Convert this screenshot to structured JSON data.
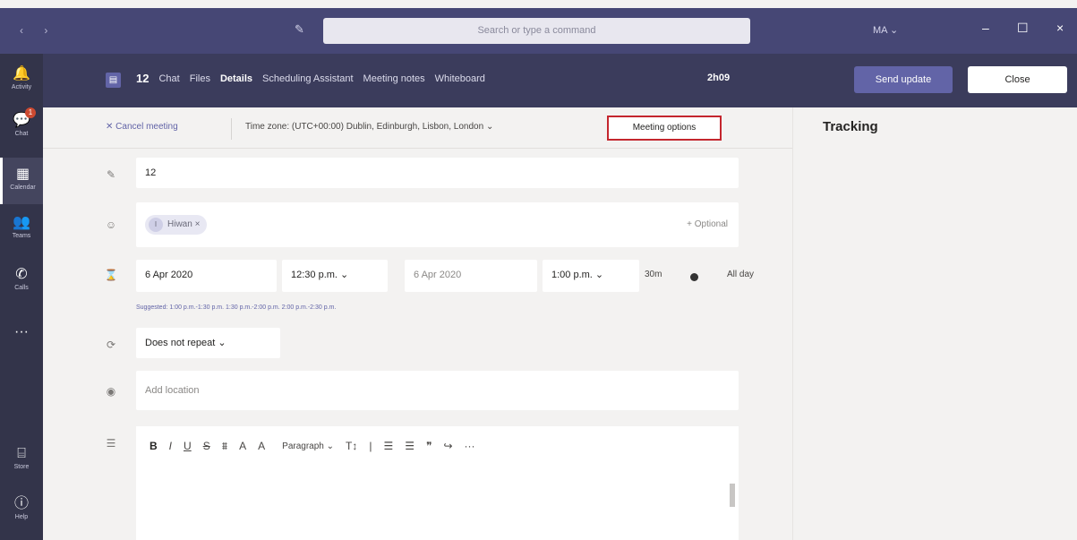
{
  "titlebar": {
    "search_placeholder": "Search or type a command",
    "user": "MA",
    "nav_arrows": "‹ ›",
    "compose_icon": "compose-icon",
    "min": "–",
    "max": "☐",
    "close": "×"
  },
  "rail": {
    "items": [
      {
        "label": "Activity",
        "icon": "bell-icon",
        "glyph": "🔔"
      },
      {
        "label": "Chat",
        "icon": "chat-icon",
        "glyph": "💬",
        "badge": "1"
      },
      {
        "label": "Calendar",
        "icon": "calendar-icon",
        "glyph": "▦"
      },
      {
        "label": "Teams",
        "icon": "teams-icon",
        "glyph": "👥"
      },
      {
        "label": "Calls",
        "icon": "phone-icon",
        "glyph": "✆"
      },
      {
        "label": "",
        "icon": "more-icon",
        "glyph": "···"
      },
      {
        "label": "Store",
        "icon": "store-icon",
        "glyph": "⌸"
      },
      {
        "label": "Help",
        "icon": "help-icon",
        "glyph": "ⓘ"
      }
    ]
  },
  "header": {
    "meeting_count": "12",
    "tabs": [
      "Chat",
      "Files",
      "Details",
      "Scheduling Assistant",
      "Meeting notes",
      "Whiteboard"
    ],
    "active_tab": "Details",
    "timer": "2h09",
    "send_update": "Send update",
    "close": "Close"
  },
  "toolbar": {
    "cancel": "✕ Cancel meeting",
    "timezone": "Time zone: (UTC+00:00) Dublin, Edinburgh, Lisbon, London  ⌄",
    "meeting_options": "Meeting options"
  },
  "tracking": {
    "title": "Tracking"
  },
  "form": {
    "title_value": "12",
    "attendee": "Hiwan",
    "attendee_initial": "I",
    "optional": "+ Optional",
    "start_date": "6 Apr 2020",
    "start_time": "12:30 p.m.  ⌄",
    "end_date": "6 Apr 2020",
    "end_time": "1:00 p.m.  ⌄",
    "duration": "30m",
    "all_day": "All day",
    "suggestions": "Suggested: 1:00 p.m.-1:30 p.m.  1:30 p.m.-2:00 p.m.  2:00 p.m.-2:30 p.m.",
    "repeat": "Does not repeat  ⌄",
    "location_placeholder": "Add location"
  },
  "editor": {
    "paragraph": "Paragraph ⌄",
    "font_size": "T↕",
    "buttons": [
      "B",
      "I",
      "U",
      "S",
      "⩩",
      "A",
      "A"
    ],
    "list_buttons": [
      "|",
      "☰",
      "☰",
      "❞",
      "↪",
      "···"
    ]
  },
  "colors": {
    "titlebar": "#464775",
    "rail": "#33344a",
    "header": "#3b3c5c",
    "accent": "#6264a7",
    "highlight_border": "#c4262e"
  }
}
